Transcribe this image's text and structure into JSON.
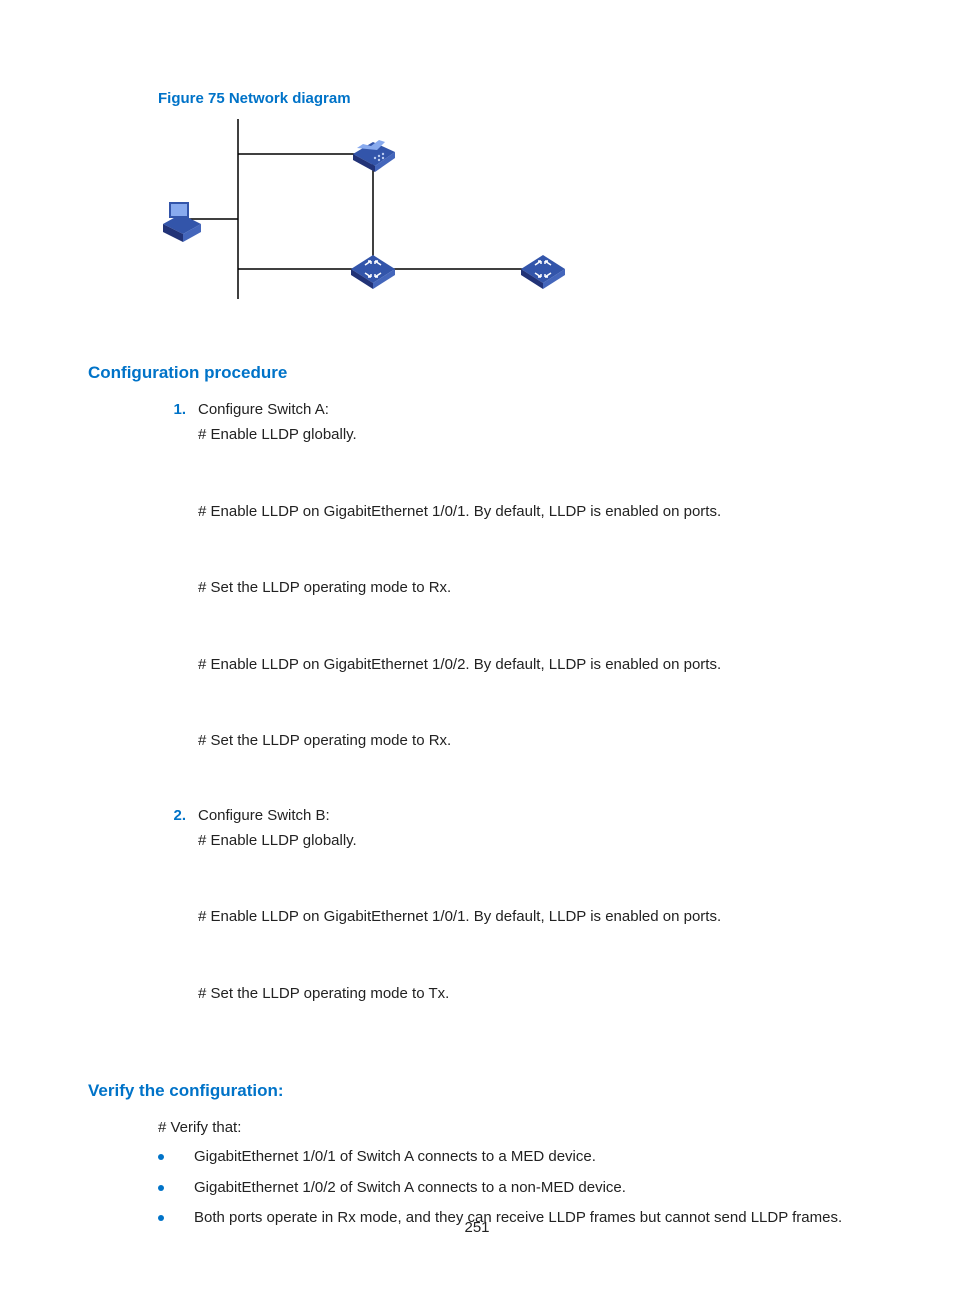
{
  "figure_caption": "Figure 75 Network diagram",
  "sections": {
    "config_procedure": {
      "heading": "Configuration procedure",
      "step1_num": "1.",
      "step1_title": "Configure Switch A:",
      "step1_lines": [
        "# Enable LLDP globally.",
        "# Enable LLDP on GigabitEthernet 1/0/1. By default, LLDP is enabled on ports.",
        "# Set the LLDP operating mode to Rx.",
        "# Enable LLDP on GigabitEthernet 1/0/2. By default, LLDP is enabled on ports.",
        "# Set the LLDP operating mode to Rx."
      ],
      "step2_num": "2.",
      "step2_title": "Configure Switch B:",
      "step2_lines": [
        "# Enable LLDP globally.",
        "# Enable LLDP on GigabitEthernet 1/0/1. By default, LLDP is enabled on ports.",
        "# Set the LLDP operating mode to Tx."
      ]
    },
    "verify": {
      "heading": "Verify the configuration:",
      "intro": "# Verify that:",
      "bullets": [
        "GigabitEthernet 1/0/1 of Switch A connects to a MED device.",
        "GigabitEthernet 1/0/2 of Switch A connects to a non-MED device.",
        "Both ports operate in Rx mode, and they can receive LLDP frames but cannot send LLDP frames."
      ]
    }
  },
  "page_number": "251"
}
